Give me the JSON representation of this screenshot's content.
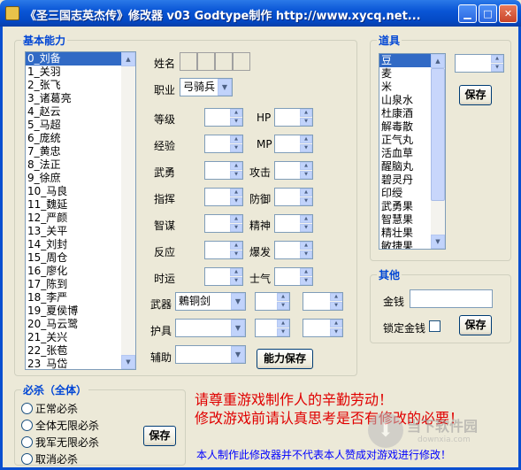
{
  "window": {
    "title": "《圣三国志英杰传》修改器 v03  Godtype制作 http://www.xycq.net...",
    "min_icon": "minimize-icon",
    "max_icon": "maximize-icon",
    "close_icon": "close-icon"
  },
  "basic": {
    "group_title": "基本能力",
    "characters": [
      "0_刘备",
      "1_关羽",
      "2_张飞",
      "3_诸葛亮",
      "4_赵云",
      "5_马超",
      "6_庞统",
      "7_黄忠",
      "8_法正",
      "9_徐庶",
      "10_马良",
      "11_魏延",
      "12_严颜",
      "13_关平",
      "14_刘封",
      "15_周仓",
      "16_廖化",
      "17_陈到",
      "18_李严",
      "19_夏侯博",
      "20_马云鹭",
      "21_关兴",
      "22_张苞",
      "23_马岱"
    ],
    "selected_index": 0,
    "labels": {
      "name": "姓名",
      "class": "职业",
      "level": "等级",
      "hp": "HP",
      "exp": "经验",
      "mp": "MP",
      "force": "武勇",
      "attack": "攻击",
      "command": "指挥",
      "defense": "防御",
      "intellect": "智谋",
      "spirit": "精神",
      "reaction": "反应",
      "burst": "爆发",
      "luck": "时运",
      "morale": "士气",
      "weapon": "武器",
      "armor": "护具",
      "aux": "辅助"
    },
    "class_value": "弓骑兵",
    "weapon_value": "鶫铜剑",
    "save_label": "能力保存"
  },
  "items": {
    "group_title": "道具",
    "list": [
      "豆",
      "麦",
      "米",
      "山泉水",
      "杜康酒",
      "解毒散",
      "正气丸",
      "活血草",
      "醒脑丸",
      "碧灵丹",
      "印绶",
      "武勇果",
      "智慧果",
      "精壮果",
      "敏捷果"
    ],
    "selected_index": 0,
    "save_label": "保存"
  },
  "other": {
    "group_title": "其他",
    "money_label": "金钱",
    "lock_label": "锁定金钱",
    "save_label": "保存"
  },
  "kill": {
    "group_title": "必杀（全体）",
    "options": [
      "正常必杀",
      "全体无限必杀",
      "我军无限必杀",
      "取消必杀"
    ],
    "save_label": "保存"
  },
  "notice": {
    "warning_line1": "请尊重游戏制作人的辛勤劳动！",
    "warning_line2": "修改游戏前请认真思考是否有修改的必要！",
    "disclaimer": "本人制作此修改器并不代表本人赞成对游戏进行修改！"
  },
  "watermark": {
    "icon": "download-arrow-icon",
    "text": "当下软件园",
    "sub": "downxia.com"
  }
}
